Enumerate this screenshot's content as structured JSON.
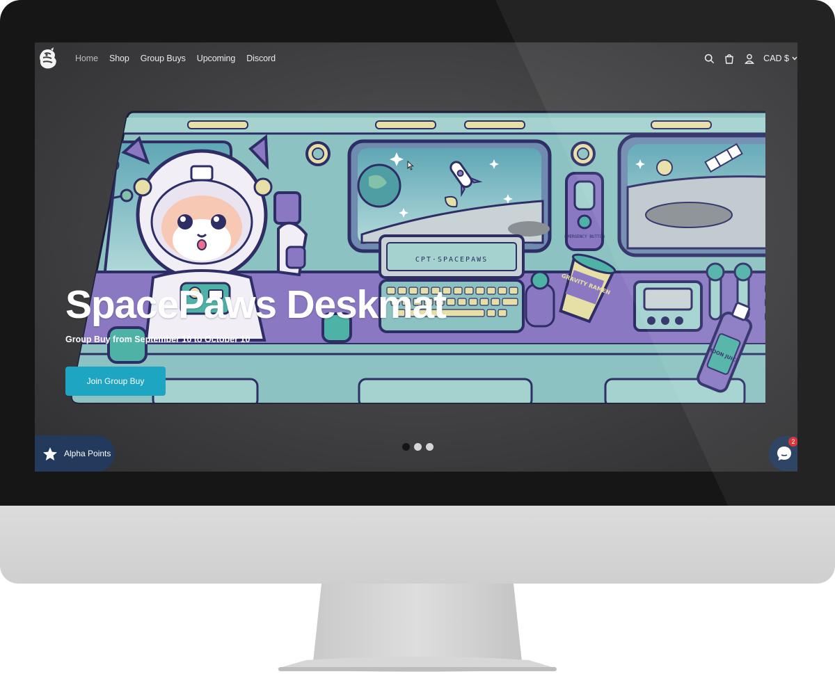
{
  "nav": {
    "links": [
      {
        "label": "Home",
        "active": true
      },
      {
        "label": "Shop",
        "active": false
      },
      {
        "label": "Group Buys",
        "active": false
      },
      {
        "label": "Upcoming",
        "active": false
      },
      {
        "label": "Discord",
        "active": false
      }
    ],
    "icons": [
      "search-icon",
      "cart-icon",
      "account-icon"
    ],
    "currency": "CAD $"
  },
  "hero": {
    "title": "SpacePaws Deskmat",
    "subtitle": "Group Buy from September 10 to October 10",
    "cta_label": "Join Group Buy",
    "art_text": {
      "console": "CPT·SPACEPAWS",
      "panel": "EMERGENCY BUTTON",
      "cup": "GRAVITY RAMEN",
      "bottle": "MOON JUICE"
    }
  },
  "slider": {
    "count": 3,
    "active_index": 0
  },
  "rewards": {
    "label": "Alpha Points"
  },
  "chat": {
    "badge": "2"
  },
  "colors": {
    "accent": "#1ea5c1",
    "widget": "#233a5c",
    "mat_teal": "#8cc3c2",
    "mat_purple": "#8a79c2",
    "mat_outline": "#2e2d66"
  }
}
